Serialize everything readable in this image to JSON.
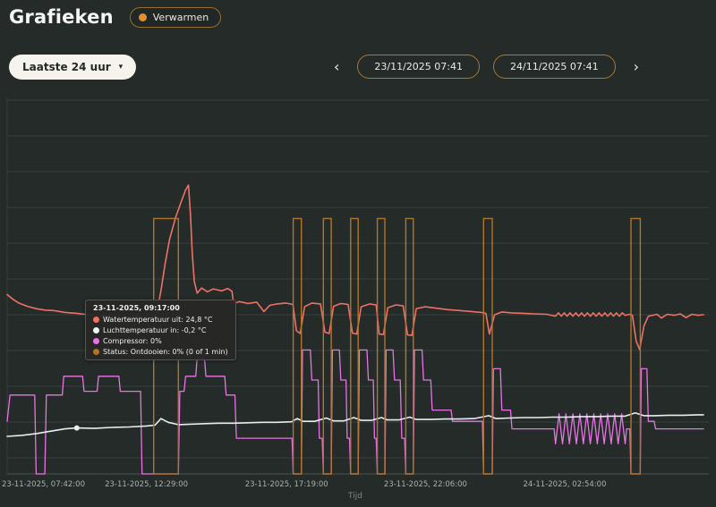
{
  "page": {
    "title": "Grafieken",
    "mode_badge_label": "Verwarmen"
  },
  "icons": {
    "chevron_down": "▾",
    "chevron_left": "‹",
    "chevron_right": "›"
  },
  "controls": {
    "range_label": "Laatste 24 uur",
    "date_from": "23/11/2025 07:41",
    "date_to": "24/11/2025 07:41"
  },
  "tooltip": {
    "title": "23-11-2025, 09:17:00",
    "rows": [
      {
        "color": "#ee7166",
        "label": "Watertemperatuur uit: 24,8 °C"
      },
      {
        "color": "#eef4f5",
        "label": "Luchttemperatuur in: -0,2 °C"
      },
      {
        "color": "#e873e4",
        "label": "Compressor: 0%"
      },
      {
        "color": "#b0752b",
        "label": "Status: Ontdooien: 0% (0 of 1 min)"
      }
    ]
  },
  "chart_data": {
    "type": "line",
    "title": "",
    "xlabel": "Tijd",
    "x_unit": "hours since 23-11-2025 07:41",
    "x_range": [
      0,
      24
    ],
    "temp_axis_range": [
      -10,
      70
    ],
    "percent_axis_range": [
      0,
      100
    ],
    "grid": true,
    "legend_position": "hidden",
    "x_ticks": [
      {
        "h": 0.02,
        "label": "23-11-2025, 07:42:00"
      },
      {
        "h": 4.8,
        "label": "23-11-2025, 12:29:00"
      },
      {
        "h": 9.63,
        "label": "23-11-2025, 17:19:00"
      },
      {
        "h": 14.42,
        "label": "23-11-2025, 22:06:00"
      },
      {
        "h": 19.22,
        "label": "24-11-2025, 02:54:00"
      }
    ],
    "series": [
      {
        "name": "Compressor",
        "unit": "%",
        "axis": "percent",
        "color": "#e873e4",
        "points": [
          [
            0,
            14
          ],
          [
            0.1,
            21
          ],
          [
            0.95,
            21
          ],
          [
            1.0,
            0
          ],
          [
            1.3,
            0
          ],
          [
            1.35,
            21
          ],
          [
            1.9,
            21
          ],
          [
            1.95,
            26
          ],
          [
            2.6,
            26
          ],
          [
            2.65,
            22
          ],
          [
            3.1,
            22
          ],
          [
            3.15,
            26
          ],
          [
            3.85,
            26
          ],
          [
            3.9,
            22
          ],
          [
            4.6,
            22
          ],
          [
            4.65,
            0
          ],
          [
            5.9,
            0
          ],
          [
            5.95,
            22
          ],
          [
            6.1,
            22
          ],
          [
            6.15,
            26
          ],
          [
            6.5,
            26
          ],
          [
            6.55,
            31
          ],
          [
            6.8,
            31
          ],
          [
            6.85,
            26
          ],
          [
            7.5,
            26
          ],
          [
            7.55,
            21
          ],
          [
            7.85,
            21
          ],
          [
            7.9,
            9.5
          ],
          [
            9.82,
            9.5
          ],
          [
            9.86,
            0
          ],
          [
            10.14,
            0
          ],
          [
            10.18,
            33
          ],
          [
            10.45,
            33
          ],
          [
            10.5,
            25
          ],
          [
            10.72,
            25
          ],
          [
            10.76,
            9.5
          ],
          [
            10.86,
            9.5
          ],
          [
            10.9,
            0
          ],
          [
            11.17,
            0
          ],
          [
            11.21,
            33
          ],
          [
            11.45,
            33
          ],
          [
            11.5,
            25
          ],
          [
            11.68,
            25
          ],
          [
            11.72,
            9.5
          ],
          [
            11.8,
            9.5
          ],
          [
            11.84,
            0
          ],
          [
            12.1,
            0
          ],
          [
            12.14,
            33
          ],
          [
            12.4,
            33
          ],
          [
            12.45,
            25
          ],
          [
            12.62,
            25
          ],
          [
            12.66,
            9.5
          ],
          [
            12.72,
            9.5
          ],
          [
            12.76,
            0
          ],
          [
            13.02,
            0
          ],
          [
            13.06,
            33
          ],
          [
            13.3,
            33
          ],
          [
            13.35,
            25
          ],
          [
            13.55,
            25
          ],
          [
            13.6,
            9.5
          ],
          [
            13.7,
            9.5
          ],
          [
            13.74,
            0
          ],
          [
            14.0,
            0
          ],
          [
            14.04,
            33
          ],
          [
            14.3,
            33
          ],
          [
            14.35,
            25
          ],
          [
            14.6,
            25
          ],
          [
            14.65,
            17
          ],
          [
            15.3,
            17
          ],
          [
            15.35,
            14
          ],
          [
            16.38,
            14
          ],
          [
            16.42,
            0
          ],
          [
            16.72,
            0
          ],
          [
            16.76,
            28
          ],
          [
            17.0,
            28
          ],
          [
            17.05,
            17
          ],
          [
            17.35,
            17
          ],
          [
            17.4,
            12
          ],
          [
            18.85,
            12
          ],
          [
            18.9,
            8
          ],
          [
            19.02,
            16
          ],
          [
            19.14,
            8
          ],
          [
            19.26,
            16
          ],
          [
            19.38,
            8
          ],
          [
            19.5,
            16
          ],
          [
            19.62,
            8
          ],
          [
            19.74,
            16
          ],
          [
            19.86,
            8
          ],
          [
            19.98,
            16
          ],
          [
            20.1,
            8
          ],
          [
            20.22,
            16
          ],
          [
            20.34,
            8
          ],
          [
            20.46,
            16
          ],
          [
            20.58,
            8
          ],
          [
            20.7,
            16
          ],
          [
            20.82,
            8
          ],
          [
            20.94,
            16
          ],
          [
            21.06,
            8
          ],
          [
            21.18,
            16
          ],
          [
            21.3,
            8
          ],
          [
            21.35,
            12
          ],
          [
            21.46,
            12
          ],
          [
            21.5,
            0
          ],
          [
            21.82,
            0
          ],
          [
            21.86,
            28
          ],
          [
            22.05,
            28
          ],
          [
            22.1,
            14
          ],
          [
            22.3,
            14
          ],
          [
            22.35,
            12
          ],
          [
            24,
            12
          ]
        ]
      },
      {
        "name": "Luchttemperatuur in",
        "unit": "°C",
        "axis": "temp",
        "color": "#e7eef0",
        "points": [
          [
            0,
            -2.0
          ],
          [
            0.5,
            -1.8
          ],
          [
            1.0,
            -1.4
          ],
          [
            1.6,
            -0.8
          ],
          [
            2.0,
            -0.4
          ],
          [
            2.4,
            -0.2
          ],
          [
            3.0,
            -0.3
          ],
          [
            3.6,
            -0.1
          ],
          [
            4.2,
            0.0
          ],
          [
            4.8,
            0.2
          ],
          [
            5.1,
            0.4
          ],
          [
            5.3,
            1.8
          ],
          [
            5.55,
            1.0
          ],
          [
            5.9,
            0.5
          ],
          [
            6.3,
            0.6
          ],
          [
            6.8,
            0.7
          ],
          [
            7.3,
            0.8
          ],
          [
            7.8,
            0.8
          ],
          [
            8.3,
            0.9
          ],
          [
            8.8,
            1.0
          ],
          [
            9.3,
            1.0
          ],
          [
            9.8,
            1.1
          ],
          [
            10.0,
            1.8
          ],
          [
            10.2,
            1.2
          ],
          [
            10.6,
            1.2
          ],
          [
            11.0,
            1.9
          ],
          [
            11.25,
            1.3
          ],
          [
            11.6,
            1.3
          ],
          [
            11.95,
            2.0
          ],
          [
            12.2,
            1.4
          ],
          [
            12.55,
            1.4
          ],
          [
            12.9,
            2.0
          ],
          [
            13.1,
            1.5
          ],
          [
            13.5,
            1.5
          ],
          [
            13.88,
            2.1
          ],
          [
            14.1,
            1.6
          ],
          [
            14.6,
            1.6
          ],
          [
            15.1,
            1.7
          ],
          [
            15.6,
            1.7
          ],
          [
            16.1,
            1.8
          ],
          [
            16.6,
            2.4
          ],
          [
            16.85,
            1.8
          ],
          [
            17.3,
            1.9
          ],
          [
            17.8,
            2.0
          ],
          [
            18.3,
            2.0
          ],
          [
            18.8,
            2.1
          ],
          [
            19.3,
            2.1
          ],
          [
            19.8,
            2.2
          ],
          [
            20.3,
            2.2
          ],
          [
            20.8,
            2.3
          ],
          [
            21.3,
            2.3
          ],
          [
            21.65,
            3.0
          ],
          [
            21.95,
            2.4
          ],
          [
            22.3,
            2.4
          ],
          [
            22.8,
            2.5
          ],
          [
            23.3,
            2.5
          ],
          [
            23.8,
            2.6
          ],
          [
            24,
            2.6
          ]
        ]
      },
      {
        "name": "Watertemperatuur uit",
        "unit": "°C",
        "axis": "temp",
        "color": "#ee7166",
        "points": [
          [
            0,
            28.2
          ],
          [
            0.2,
            27.2
          ],
          [
            0.4,
            26.4
          ],
          [
            0.7,
            25.7
          ],
          [
            1.0,
            25.2
          ],
          [
            1.3,
            24.9
          ],
          [
            1.6,
            24.8
          ],
          [
            2.0,
            24.4
          ],
          [
            2.4,
            24.2
          ],
          [
            2.8,
            23.9
          ],
          [
            3.2,
            23.7
          ],
          [
            3.6,
            23.8
          ],
          [
            3.9,
            23.4
          ],
          [
            4.2,
            23.3
          ],
          [
            4.5,
            23.5
          ],
          [
            4.8,
            23.2
          ],
          [
            5.05,
            23.0
          ],
          [
            5.15,
            24.0
          ],
          [
            5.3,
            29
          ],
          [
            5.45,
            35
          ],
          [
            5.6,
            40
          ],
          [
            5.8,
            44.5
          ],
          [
            6.0,
            48
          ],
          [
            6.15,
            50.5
          ],
          [
            6.25,
            51.5
          ],
          [
            6.32,
            45
          ],
          [
            6.38,
            37
          ],
          [
            6.45,
            31
          ],
          [
            6.55,
            28.5
          ],
          [
            6.7,
            29.6
          ],
          [
            6.9,
            28.8
          ],
          [
            7.1,
            29.4
          ],
          [
            7.4,
            29.0
          ],
          [
            7.6,
            29.5
          ],
          [
            7.75,
            28.9
          ],
          [
            7.8,
            26.2
          ],
          [
            8.0,
            26.7
          ],
          [
            8.3,
            26.3
          ],
          [
            8.6,
            26.6
          ],
          [
            8.85,
            24.6
          ],
          [
            9.05,
            25.9
          ],
          [
            9.3,
            26.2
          ],
          [
            9.6,
            26.4
          ],
          [
            9.85,
            26.1
          ],
          [
            9.97,
            20.5
          ],
          [
            10.1,
            19.9
          ],
          [
            10.25,
            25.6
          ],
          [
            10.5,
            26.4
          ],
          [
            10.8,
            26.2
          ],
          [
            10.95,
            20.2
          ],
          [
            11.1,
            19.9
          ],
          [
            11.25,
            25.7
          ],
          [
            11.5,
            26.3
          ],
          [
            11.75,
            26.1
          ],
          [
            11.9,
            20.0
          ],
          [
            12.05,
            19.8
          ],
          [
            12.2,
            25.6
          ],
          [
            12.5,
            26.2
          ],
          [
            12.72,
            26.0
          ],
          [
            12.82,
            19.8
          ],
          [
            12.97,
            19.7
          ],
          [
            13.12,
            25.4
          ],
          [
            13.4,
            26.0
          ],
          [
            13.65,
            25.8
          ],
          [
            13.8,
            19.6
          ],
          [
            13.95,
            19.5
          ],
          [
            14.1,
            25.2
          ],
          [
            14.4,
            25.6
          ],
          [
            14.8,
            25.3
          ],
          [
            15.2,
            25.0
          ],
          [
            15.6,
            24.8
          ],
          [
            16.0,
            24.6
          ],
          [
            16.35,
            24.4
          ],
          [
            16.5,
            24.2
          ],
          [
            16.62,
            19.8
          ],
          [
            16.8,
            23.9
          ],
          [
            17.05,
            24.5
          ],
          [
            17.4,
            24.3
          ],
          [
            17.8,
            24.2
          ],
          [
            18.2,
            24.1
          ],
          [
            18.6,
            24.0
          ],
          [
            18.9,
            23.6
          ],
          [
            19.0,
            24.3
          ],
          [
            19.1,
            23.6
          ],
          [
            19.2,
            24.3
          ],
          [
            19.3,
            23.6
          ],
          [
            19.4,
            24.3
          ],
          [
            19.5,
            23.6
          ],
          [
            19.6,
            24.3
          ],
          [
            19.7,
            23.6
          ],
          [
            19.8,
            24.3
          ],
          [
            19.9,
            23.6
          ],
          [
            20.0,
            24.3
          ],
          [
            20.1,
            23.6
          ],
          [
            20.2,
            24.3
          ],
          [
            20.3,
            23.6
          ],
          [
            20.4,
            24.3
          ],
          [
            20.5,
            23.6
          ],
          [
            20.6,
            24.3
          ],
          [
            20.7,
            23.6
          ],
          [
            20.8,
            24.3
          ],
          [
            20.9,
            23.6
          ],
          [
            21.0,
            24.3
          ],
          [
            21.1,
            23.6
          ],
          [
            21.2,
            24.3
          ],
          [
            21.3,
            23.8
          ],
          [
            21.45,
            24.0
          ],
          [
            21.55,
            23.8
          ],
          [
            21.68,
            18.3
          ],
          [
            21.8,
            16.5
          ],
          [
            21.95,
            21.5
          ],
          [
            22.1,
            23.6
          ],
          [
            22.4,
            24.0
          ],
          [
            22.55,
            23.2
          ],
          [
            22.75,
            24.0
          ],
          [
            23.0,
            23.8
          ],
          [
            23.2,
            24.1
          ],
          [
            23.4,
            23.3
          ],
          [
            23.6,
            24.0
          ],
          [
            23.8,
            23.8
          ],
          [
            24,
            23.9
          ]
        ]
      },
      {
        "name": "Status: Ontdooien",
        "unit": "",
        "axis": "percent",
        "color": "#b0752b",
        "style": "interval",
        "level": 68,
        "intervals": [
          [
            5.05,
            5.9
          ],
          [
            9.86,
            10.14
          ],
          [
            10.9,
            11.17
          ],
          [
            11.84,
            12.1
          ],
          [
            12.76,
            13.02
          ],
          [
            13.74,
            14.0
          ],
          [
            16.42,
            16.72
          ],
          [
            21.5,
            21.82
          ]
        ]
      }
    ],
    "markers": [
      {
        "axis": "temp",
        "h": 2.4,
        "value": -0.2,
        "color": "#e7eef0"
      }
    ]
  }
}
